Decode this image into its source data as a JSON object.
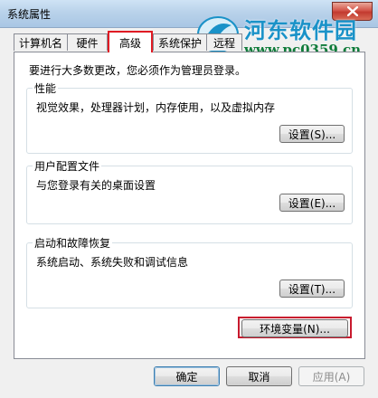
{
  "window": {
    "title": "系统属性",
    "close_icon": "close-icon"
  },
  "watermark": {
    "name": "河东软件园",
    "url": "www.pc0359.cn"
  },
  "tabs": [
    {
      "label": "计算机名",
      "active": false
    },
    {
      "label": "硬件",
      "active": false
    },
    {
      "label": "高级",
      "active": true
    },
    {
      "label": "系统保护",
      "active": false
    },
    {
      "label": "远程",
      "active": false
    }
  ],
  "advanced": {
    "intro": "要进行大多数更改，您必须作为管理员登录。",
    "performance": {
      "title": "性能",
      "description": "视觉效果，处理器计划，内存使用，以及虚拟内存",
      "button": "设置(S)..."
    },
    "user_profiles": {
      "title": "用户配置文件",
      "description": "与您登录有关的桌面设置",
      "button": "设置(E)..."
    },
    "startup_recovery": {
      "title": "启动和故障恢复",
      "description": "系统启动、系统失败和调试信息",
      "button": "设置(T)..."
    },
    "env_button": "环境变量(N)..."
  },
  "footer": {
    "ok": "确定",
    "cancel": "取消",
    "apply": "应用(A)"
  },
  "colors": {
    "highlight_border": "#e01b24",
    "accent_blue": "#1a92c8",
    "url_green": "#0f7b3a"
  }
}
